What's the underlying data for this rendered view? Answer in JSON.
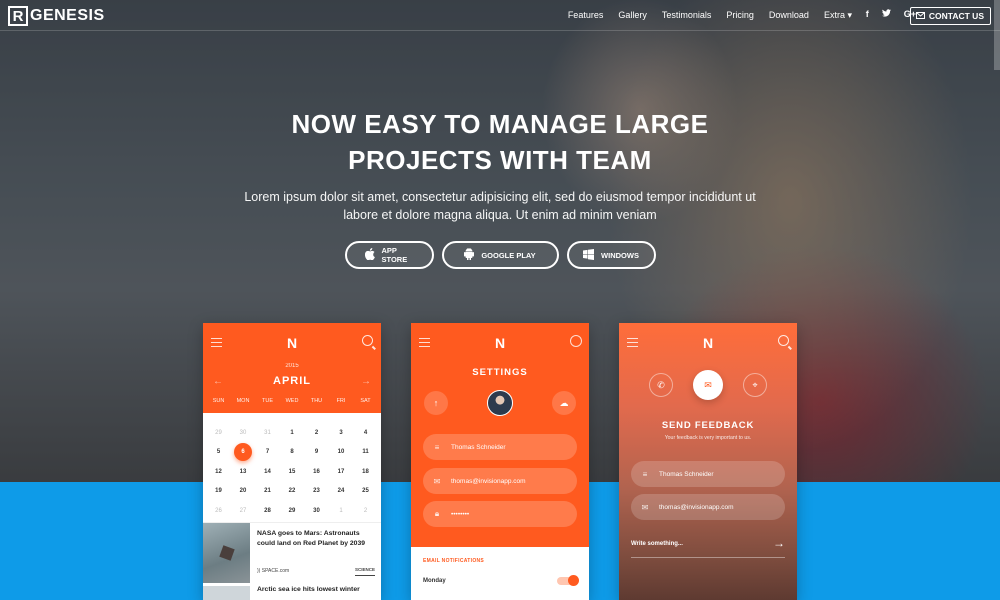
{
  "nav": {
    "logo_mark": "R",
    "logo_text": "GENESIS",
    "menu": [
      "Features",
      "Gallery",
      "Testimonials",
      "Pricing",
      "Download",
      "Extra"
    ],
    "extra_caret": "▾",
    "social": [
      "f",
      "t",
      "G+"
    ],
    "contact_label": "CONTACT US"
  },
  "hero": {
    "title_line1": "NOW EASY TO MANAGE LARGE",
    "title_line2": "PROJECTS WITH TEAM",
    "subtitle_line1": "Lorem ipsum dolor sit amet, consectetur adipisicing elit, sed do eiusmod tempor incididunt ut",
    "subtitle_line2": "labore et dolore magna aliqua. Ut enim ad minim veniam",
    "buttons": [
      "APP STORE",
      "GOOGLE PLAY",
      "WINDOWS"
    ]
  },
  "calendar": {
    "logo": "N",
    "year": "2015",
    "month": "APRIL",
    "days": [
      "SUN",
      "MON",
      "TUE",
      "WED",
      "THU",
      "FRI",
      "SAT"
    ],
    "rows": [
      [
        "29",
        "30",
        "31",
        "1",
        "2",
        "3",
        "4"
      ],
      [
        "5",
        "6",
        "7",
        "8",
        "9",
        "10",
        "11"
      ],
      [
        "12",
        "13",
        "14",
        "15",
        "16",
        "17",
        "18"
      ],
      [
        "19",
        "20",
        "21",
        "22",
        "23",
        "24",
        "25"
      ],
      [
        "26",
        "27",
        "28",
        "29",
        "30",
        "1",
        "2"
      ]
    ],
    "selected_day": "6",
    "news": [
      {
        "title": "NASA goes to Mars: Astronauts could land on Red Planet by 2039",
        "source": "SPACE.com",
        "category": "SCIENCE"
      },
      {
        "title": "Arctic sea ice hits lowest winter"
      }
    ]
  },
  "settings": {
    "logo": "N",
    "title": "SETTINGS",
    "name": "Thomas Schneider",
    "email": "thomas@invisionapp.com",
    "password": "••••••••",
    "section_label": "EMAIL NOTIFICATIONS",
    "toggle_label": "Monday"
  },
  "feedback": {
    "logo": "N",
    "title": "SEND FEEDBACK",
    "subtitle": "Your feedback is very important to us.",
    "name": "Thomas Schneider",
    "email": "thomas@invisionapp.com",
    "message_placeholder": "Write something..."
  },
  "colors": {
    "accent": "#ff5a1f",
    "blue": "#0e9be8"
  }
}
